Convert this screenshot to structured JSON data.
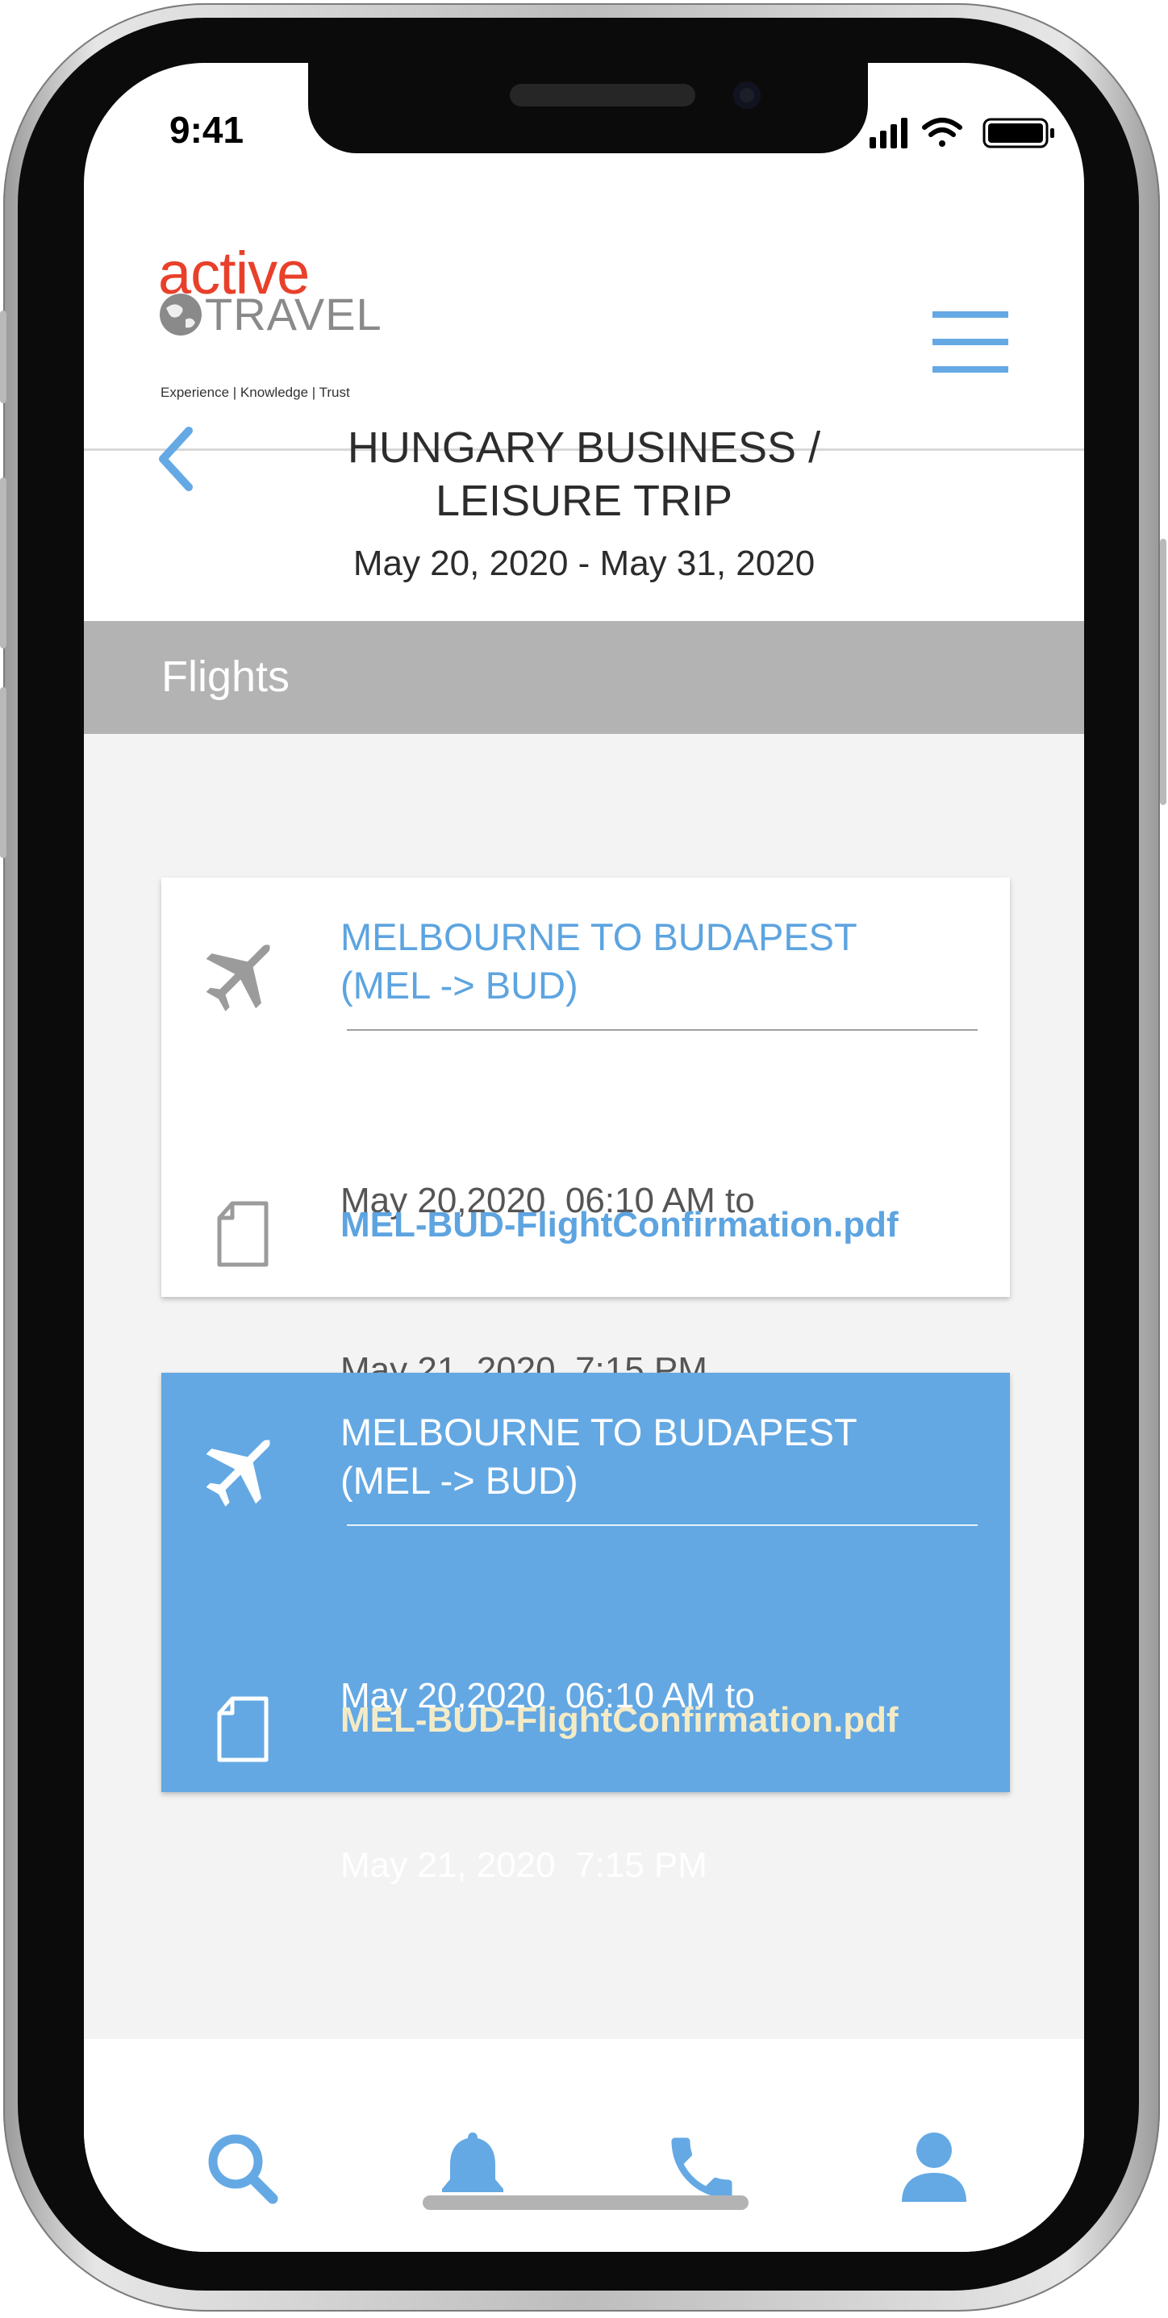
{
  "status_bar": {
    "time": "9:41"
  },
  "header": {
    "logo": {
      "word1": "active",
      "word2": "TRAVEL",
      "tagline": "Experience | Knowledge | Trust"
    }
  },
  "trip": {
    "title_line1": "HUNGARY BUSINESS /",
    "title_line2": "LEISURE TRIP",
    "dates": "May 20, 2020 - May 31, 2020"
  },
  "section": {
    "title": "Flights"
  },
  "flights": [
    {
      "route_line1": "MELBOURNE TO BUDAPEST",
      "route_line2": "(MEL -> BUD)",
      "time_line1": "May 20,2020  06:10 AM to",
      "time_line2": "May 21, 2020  7:15 PM",
      "document": "MEL-BUD-FlightConfirmation.pdf",
      "selected": false
    },
    {
      "route_line1": "MELBOURNE TO BUDAPEST",
      "route_line2": "(MEL -> BUD)",
      "time_line1": "May 20,2020  06:10 AM to",
      "time_line2": "May 21, 2020  7:15 PM",
      "document": "MEL-BUD-FlightConfirmation.pdf",
      "selected": true
    }
  ],
  "bottom_nav": [
    {
      "icon": "search-icon"
    },
    {
      "icon": "bell-icon"
    },
    {
      "icon": "phone-icon"
    },
    {
      "icon": "user-icon"
    }
  ],
  "colors": {
    "accent": "#63a8e3",
    "brand_red": "#e8402a",
    "section_bar": "#b3b3b3",
    "content_bg": "#f3f3f3",
    "pdf_highlight": "#f4ebc6"
  }
}
